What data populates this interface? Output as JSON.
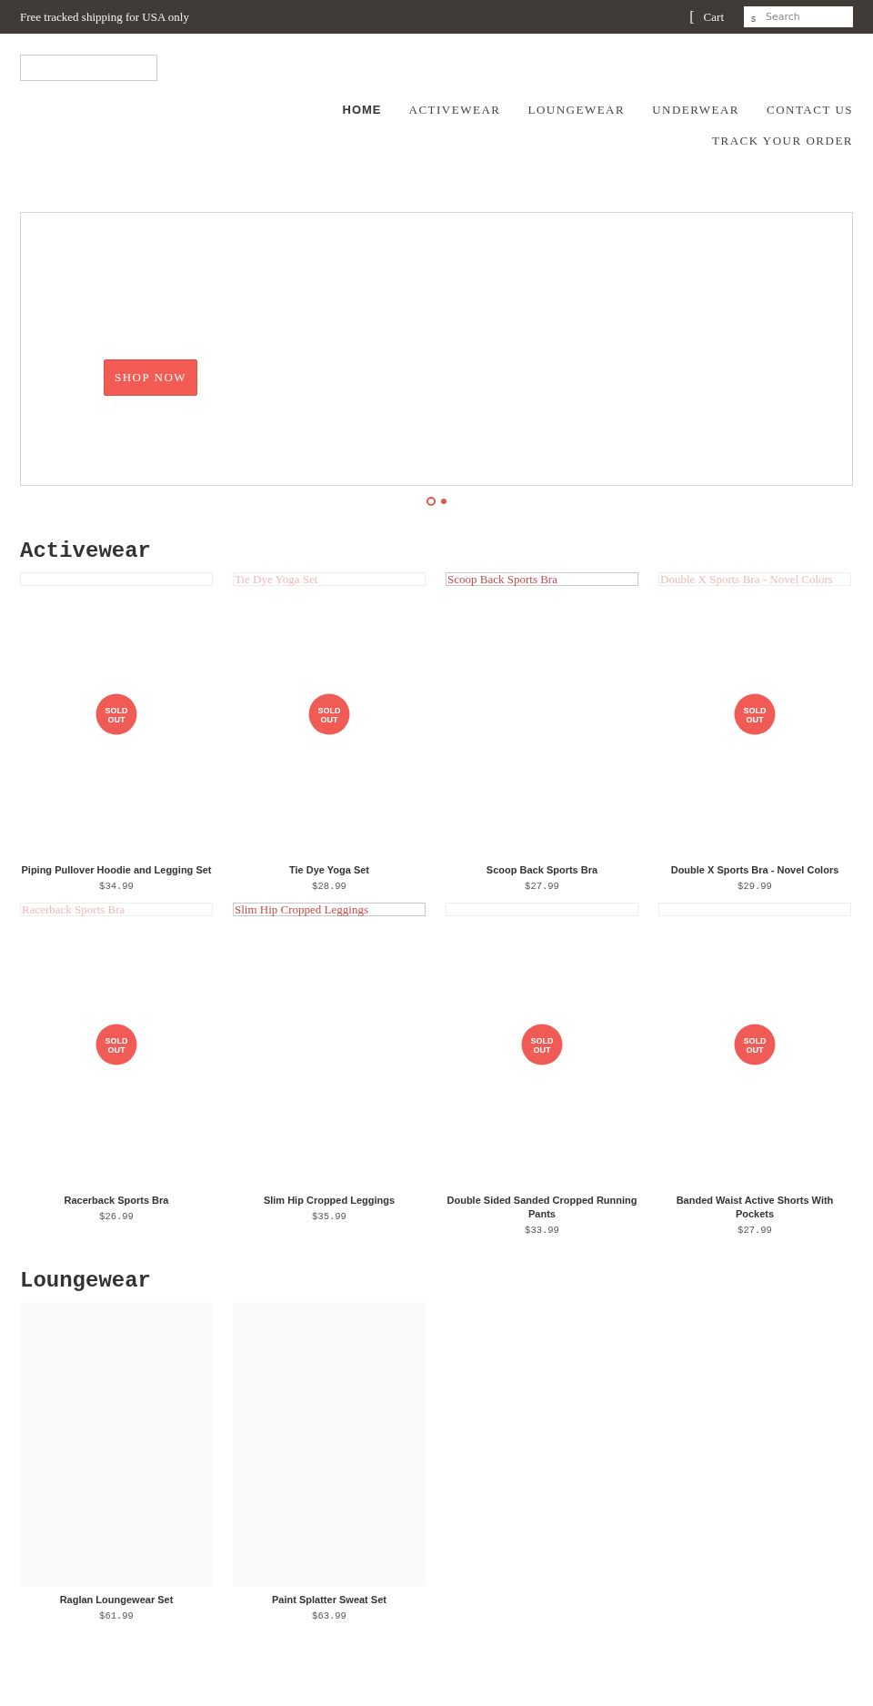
{
  "announcement": {
    "text": "Free tracked shipping for USA only",
    "cart_icon": "[",
    "cart_label": "Cart",
    "search_icon": "s",
    "search_placeholder": "Search"
  },
  "nav": [
    {
      "label": "HOME",
      "selected": true
    },
    {
      "label": "ACTIVEWEAR",
      "selected": false
    },
    {
      "label": "LOUNGEWEAR",
      "selected": false
    },
    {
      "label": "UNDERWEAR",
      "selected": false
    },
    {
      "label": "CONTACT US",
      "selected": false
    },
    {
      "label": "TRACK YOUR ORDER",
      "selected": false
    }
  ],
  "hero": {
    "button": "SHOP NOW",
    "dots": [
      {
        "selected": false
      },
      {
        "selected": true
      }
    ]
  },
  "sections": [
    {
      "title": "Activewear",
      "products": [
        {
          "kind": "broken-image",
          "name": "Piping Pullover Hoodie and Legging Set",
          "price": "$34.99",
          "badge": [
            "SOLD",
            "OUT"
          ]
        },
        {
          "kind": "broken-image",
          "alt": "Tie Dye Yoga Set",
          "alt_faded": true,
          "name": "Tie Dye Yoga Set",
          "price": "$28.99",
          "badge": [
            "SOLD",
            "OUT"
          ]
        },
        {
          "kind": "broken-image",
          "alt": "Scoop Back Sports Bra",
          "alt_faded": false,
          "name": "Scoop Back Sports Bra",
          "price": "$27.99"
        },
        {
          "kind": "broken-image",
          "alt": "Double X Sports Bra - Novel Colors",
          "alt_faded": true,
          "name": "Double X Sports Bra - Novel Colors",
          "price": "$29.99",
          "badge": [
            "SOLD",
            "OUT"
          ]
        },
        {
          "kind": "broken-image",
          "alt": "Racerback Sports Bra",
          "alt_faded": true,
          "name": "Racerback Sports Bra",
          "price": "$26.99",
          "badge": [
            "SOLD",
            "OUT"
          ]
        },
        {
          "kind": "broken-image",
          "alt": "Slim Hip Cropped Leggings",
          "alt_faded": false,
          "name": "Slim Hip Cropped Leggings",
          "price": "$35.99"
        },
        {
          "kind": "broken-image",
          "name": "Double Sided Sanded Cropped Running Pants",
          "price": "$33.99",
          "badge": [
            "SOLD",
            "OUT"
          ]
        },
        {
          "kind": "broken-image",
          "name": "Banded Waist Active Shorts With Pockets",
          "price": "$27.99",
          "badge": [
            "SOLD",
            "OUT"
          ]
        }
      ]
    },
    {
      "title": "Loungewear",
      "products": [
        {
          "kind": "placeholder",
          "name": "Raglan Loungewear Set",
          "price": "$61.99"
        },
        {
          "kind": "placeholder",
          "name": "Paint Splatter Sweat Set",
          "price": "$63.99"
        }
      ]
    }
  ]
}
